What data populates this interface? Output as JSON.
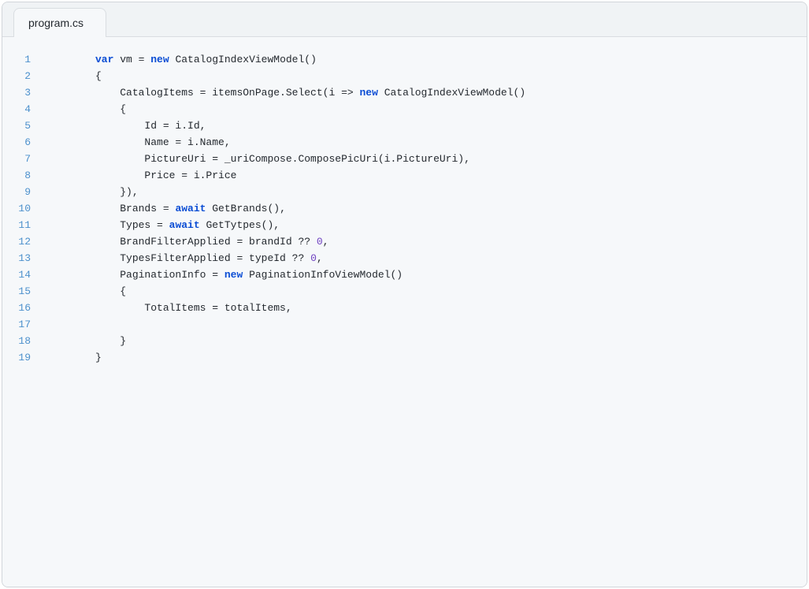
{
  "tab": {
    "filename": "program.cs"
  },
  "editor": {
    "line_count": 19,
    "lines": [
      {
        "n": 1,
        "indent": 0,
        "tokens": [
          {
            "t": "var ",
            "c": "kw"
          },
          {
            "t": "vm = ",
            "c": "plain"
          },
          {
            "t": "new ",
            "c": "kw"
          },
          {
            "t": "CatalogIndexViewModel()",
            "c": "plain"
          }
        ]
      },
      {
        "n": 2,
        "indent": 0,
        "tokens": [
          {
            "t": "{",
            "c": "plain"
          }
        ]
      },
      {
        "n": 3,
        "indent": 1,
        "tokens": [
          {
            "t": "CatalogItems = itemsOnPage.Select(i => ",
            "c": "plain"
          },
          {
            "t": "new ",
            "c": "kw"
          },
          {
            "t": "CatalogIndexViewModel()",
            "c": "plain"
          }
        ]
      },
      {
        "n": 4,
        "indent": 1,
        "tokens": [
          {
            "t": "{",
            "c": "plain"
          }
        ]
      },
      {
        "n": 5,
        "indent": 2,
        "tokens": [
          {
            "t": "Id = i.Id,",
            "c": "plain"
          }
        ]
      },
      {
        "n": 6,
        "indent": 2,
        "tokens": [
          {
            "t": "Name = i.Name,",
            "c": "plain"
          }
        ]
      },
      {
        "n": 7,
        "indent": 2,
        "tokens": [
          {
            "t": "PictureUri = _uriCompose.ComposePicUri(i.PictureUri),",
            "c": "plain"
          }
        ]
      },
      {
        "n": 8,
        "indent": 2,
        "tokens": [
          {
            "t": "Price = i.Price",
            "c": "plain"
          }
        ]
      },
      {
        "n": 9,
        "indent": 1,
        "tokens": [
          {
            "t": "}),",
            "c": "plain"
          }
        ]
      },
      {
        "n": 10,
        "indent": 1,
        "tokens": [
          {
            "t": "Brands = ",
            "c": "plain"
          },
          {
            "t": "await ",
            "c": "kw"
          },
          {
            "t": "GetBrands(),",
            "c": "plain"
          }
        ]
      },
      {
        "n": 11,
        "indent": 1,
        "tokens": [
          {
            "t": "Types = ",
            "c": "plain"
          },
          {
            "t": "await ",
            "c": "kw"
          },
          {
            "t": "GetTytpes(),",
            "c": "plain"
          }
        ]
      },
      {
        "n": 12,
        "indent": 1,
        "tokens": [
          {
            "t": "BrandFilterApplied = brandId ?? ",
            "c": "plain"
          },
          {
            "t": "0",
            "c": "num"
          },
          {
            "t": ",",
            "c": "plain"
          }
        ]
      },
      {
        "n": 13,
        "indent": 1,
        "tokens": [
          {
            "t": "TypesFilterApplied = typeId ?? ",
            "c": "plain"
          },
          {
            "t": "0",
            "c": "num"
          },
          {
            "t": ",",
            "c": "plain"
          }
        ]
      },
      {
        "n": 14,
        "indent": 1,
        "tokens": [
          {
            "t": "PaginationInfo = ",
            "c": "plain"
          },
          {
            "t": "new ",
            "c": "kw"
          },
          {
            "t": "PaginationInfoViewModel()",
            "c": "plain"
          }
        ]
      },
      {
        "n": 15,
        "indent": 1,
        "tokens": [
          {
            "t": "{",
            "c": "plain"
          }
        ]
      },
      {
        "n": 16,
        "indent": 2,
        "tokens": [
          {
            "t": "TotalItems = totalItems,",
            "c": "plain"
          }
        ]
      },
      {
        "n": 17,
        "indent": 0,
        "tokens": []
      },
      {
        "n": 18,
        "indent": 1,
        "tokens": [
          {
            "t": "}",
            "c": "plain"
          }
        ]
      },
      {
        "n": 19,
        "indent": 0,
        "tokens": [
          {
            "t": "}",
            "c": "plain"
          }
        ]
      }
    ]
  }
}
